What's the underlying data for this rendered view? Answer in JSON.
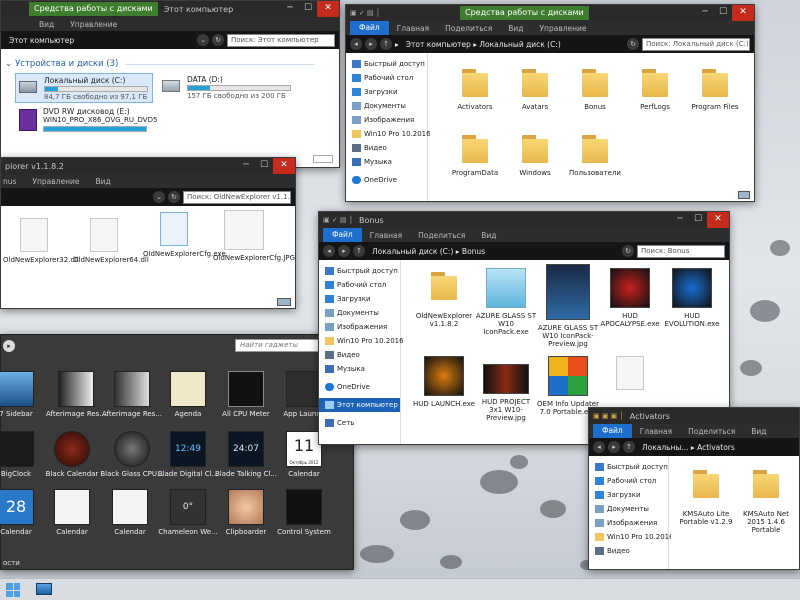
{
  "desktop": {
    "taskbar": {
      "start_icon": "windows-logo-icon",
      "pinned_icon": "computer-icon"
    }
  },
  "win_mycomputer": {
    "tabs": [
      "Средства работы с дисками",
      "Этот компьютер"
    ],
    "ribbon": [
      "Вид",
      "Управление"
    ],
    "address": "Этот компьютер",
    "search_placeholder": "Поиск: Этот компьютер",
    "group_label": "Устройства и диски (3)",
    "drives": [
      {
        "name": "Локальный диск (C:)",
        "info": "84,7 ГБ свободно из 97,1 ГБ",
        "fill": 0.13
      },
      {
        "name": "DATA (D:)",
        "info": "157 ГБ свободно из 200 ГБ",
        "fill": 0.22
      },
      {
        "name": "DVD RW дисковод (E:)",
        "sub": "WIN10_PRO_X86_OVG_RU_DVD5",
        "fill": 1.0
      }
    ]
  },
  "win_old": {
    "title": "plorer v1.1.8.2",
    "ribbon": [
      "nus",
      "Управление",
      "Вид"
    ],
    "search_placeholder": "Поиск: OldNewExplorer v1.1...",
    "items": [
      {
        "label": "OldNewExplorer32.dll"
      },
      {
        "label": "OldNewExplorer64.dll"
      },
      {
        "label": "OldNewExplorerCfg.exe"
      },
      {
        "label": "OldNewExplorerCfg.JPG"
      }
    ]
  },
  "win_c": {
    "ctx_tab": "Средства работы с дисками",
    "ribbon": [
      "Файл",
      "Главная",
      "Поделиться",
      "Вид",
      "Управление"
    ],
    "breadcrumb": [
      "Этот компьютер",
      "Локальный диск (C:)"
    ],
    "search_placeholder": "Поиск: Локальный диск (C:)",
    "nav": [
      {
        "label": "Быстрый доступ"
      },
      {
        "label": "Рабочий стол"
      },
      {
        "label": "Загрузки"
      },
      {
        "label": "Документы"
      },
      {
        "label": "Изображения"
      },
      {
        "label": "Win10 Pro 10.2016"
      },
      {
        "label": "Видео"
      },
      {
        "label": "Музыка"
      },
      {
        "label": "OneDrive"
      }
    ],
    "items": [
      {
        "label": "Activators"
      },
      {
        "label": "Avatars"
      },
      {
        "label": "Bonus"
      },
      {
        "label": "PerfLogs"
      },
      {
        "label": "Program Files"
      },
      {
        "label": "ProgramData"
      },
      {
        "label": "Windows"
      },
      {
        "label": "Пользователи"
      }
    ]
  },
  "win_bonus": {
    "title": "Bonus",
    "ribbon": [
      "Файл",
      "Главная",
      "Поделиться",
      "Вид"
    ],
    "breadcrumb": [
      "Локальный диск (C:)",
      "Bonus"
    ],
    "search_placeholder": "Поиск: Bonus",
    "nav": [
      {
        "label": "Быстрый доступ"
      },
      {
        "label": "Рабочий стол"
      },
      {
        "label": "Загрузки"
      },
      {
        "label": "Документы"
      },
      {
        "label": "Изображения"
      },
      {
        "label": "Win10 Pro 10.2016"
      },
      {
        "label": "Видео"
      },
      {
        "label": "Музыка"
      },
      {
        "label": "OneDrive"
      },
      {
        "label": "Этот компьютер"
      },
      {
        "label": "Сеть"
      }
    ],
    "items": [
      {
        "label": "OldNewExplorer v1.1.8.2"
      },
      {
        "label": "AZURE GLASS ST W10 IconPack.exe"
      },
      {
        "label": "AZURE GLASS ST W10 IconPack-Preview.jpg"
      },
      {
        "label": "HUD APOCALYPSE.exe"
      },
      {
        "label": "HUD EVOLUTION.exe"
      },
      {
        "label": "HUD LAUNCH.exe"
      },
      {
        "label": "HUD PROJECT 3x1 W10-Preview.jpg"
      },
      {
        "label": "OEM Info Updater 7.0 Portable.exe"
      }
    ]
  },
  "win_act": {
    "title": "Activators",
    "ribbon": [
      "Файл",
      "Главная",
      "Поделиться",
      "Вид"
    ],
    "breadcrumb": [
      "Локальны...",
      "Activators"
    ],
    "nav": [
      {
        "label": "Быстрый доступ"
      },
      {
        "label": "Рабочий стол"
      },
      {
        "label": "Загрузки"
      },
      {
        "label": "Документы"
      },
      {
        "label": "Изображения"
      },
      {
        "label": "Win10 Pro 10.2016"
      },
      {
        "label": "Видео"
      }
    ],
    "items": [
      {
        "label": "KMSAuto Lite Portable v1.2.9"
      },
      {
        "label": "KMSAuto Net 2015 1.4.6 Portable"
      }
    ]
  },
  "gadgets": {
    "search_placeholder": "Найти гаджеты",
    "footer_text": "ости",
    "items": [
      {
        "label": "7 Sidebar"
      },
      {
        "label": "Afterimage Res..."
      },
      {
        "label": "Afterimage Res..."
      },
      {
        "label": "Agenda"
      },
      {
        "label": "All CPU Meter"
      },
      {
        "label": "App Launch"
      },
      {
        "label": "BigClock"
      },
      {
        "label": "Black Calendar"
      },
      {
        "label": "Black Glass CPU..."
      },
      {
        "label": "Blade Digital Cl..."
      },
      {
        "label": "Blade Talking Cl..."
      },
      {
        "label": "Calendar"
      },
      {
        "label": "Calendar"
      },
      {
        "label": "Calendar"
      },
      {
        "label": "Calendar"
      },
      {
        "label": "Chameleon We..."
      },
      {
        "label": "Clipboarder"
      },
      {
        "label": "Control System"
      }
    ],
    "clock_text": "12:49",
    "clock_text2": "24:07",
    "calendar_day": "11",
    "calendar_day2": "28",
    "calendar_month": "Октябрь 2012",
    "weather_temp": "0°"
  },
  "colors": {
    "accent": "#1e6fcc",
    "titlebar": "#2a2a2a",
    "ctx_green": "#3f7d2e",
    "folder": "#f8d775"
  }
}
